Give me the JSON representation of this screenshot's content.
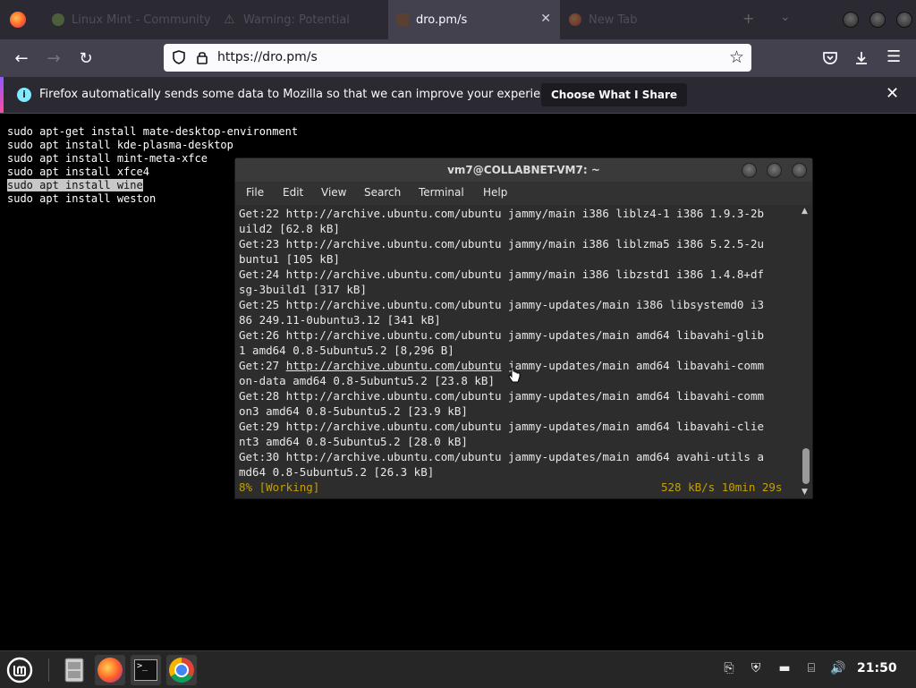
{
  "tabs": [
    {
      "label": "Linux Mint - Community"
    },
    {
      "label": "Warning: Potential"
    },
    {
      "label": "dro.pm/s"
    },
    {
      "label": "New Tab"
    }
  ],
  "url": "https://dro.pm/s",
  "notification": {
    "message": "Firefox automatically sends some data to Mozilla so that we can improve your experience.",
    "button": "Choose What I Share"
  },
  "page_lines": [
    "sudo apt-get install mate-desktop-environment",
    "sudo apt install kde-plasma-desktop",
    "sudo apt install mint-meta-xfce",
    "sudo apt install xfce4",
    "sudo apt install wine",
    "sudo apt install weston"
  ],
  "terminal": {
    "title": "vm7@COLLABNET-VM7: ~",
    "menu": [
      "File",
      "Edit",
      "View",
      "Search",
      "Terminal",
      "Help"
    ],
    "lines": [
      "Get:22 http://archive.ubuntu.com/ubuntu jammy/main i386 liblz4-1 i386 1.9.3-2b",
      "uild2 [62.8 kB]",
      "Get:23 http://archive.ubuntu.com/ubuntu jammy/main i386 liblzma5 i386 5.2.5-2u",
      "buntu1 [105 kB]",
      "Get:24 http://archive.ubuntu.com/ubuntu jammy/main i386 libzstd1 i386 1.4.8+df",
      "sg-3build1 [317 kB]",
      "Get:25 http://archive.ubuntu.com/ubuntu jammy-updates/main i386 libsystemd0 i3",
      "86 249.11-0ubuntu3.12 [341 kB]",
      "Get:26 http://archive.ubuntu.com/ubuntu jammy-updates/main amd64 libavahi-glib",
      "1 amd64 0.8-5ubuntu5.2 [8,296 B]",
      "Get:27 http://archive.ubuntu.com/ubuntu jammy-updates/main amd64 libavahi-comm",
      "on-data amd64 0.8-5ubuntu5.2 [23.8 kB]",
      "Get:28 http://archive.ubuntu.com/ubuntu jammy-updates/main amd64 libavahi-comm",
      "on3 amd64 0.8-5ubuntu5.2 [23.9 kB]",
      "Get:29 http://archive.ubuntu.com/ubuntu jammy-updates/main amd64 libavahi-clie",
      "nt3 amd64 0.8-5ubuntu5.2 [28.0 kB]",
      "Get:30 http://archive.ubuntu.com/ubuntu jammy-updates/main amd64 avahi-utils a",
      "md64 0.8-5ubuntu5.2 [26.3 kB]"
    ],
    "status_left": "8% [Working]",
    "status_right": "528 kB/s 10min 29s"
  },
  "clock": "21:50",
  "icons": {
    "firefox": "firefox-icon",
    "shield": "tracking-shield-icon",
    "lock": "lock-icon",
    "star": "bookmark-star-icon",
    "pocket": "pocket-icon",
    "download": "download-icon",
    "menu": "hamburger-menu-icon"
  },
  "colors": {
    "accent": "#9059ff",
    "terminal_bg": "#2d2d2d",
    "status_yellow": "#c4a000"
  }
}
